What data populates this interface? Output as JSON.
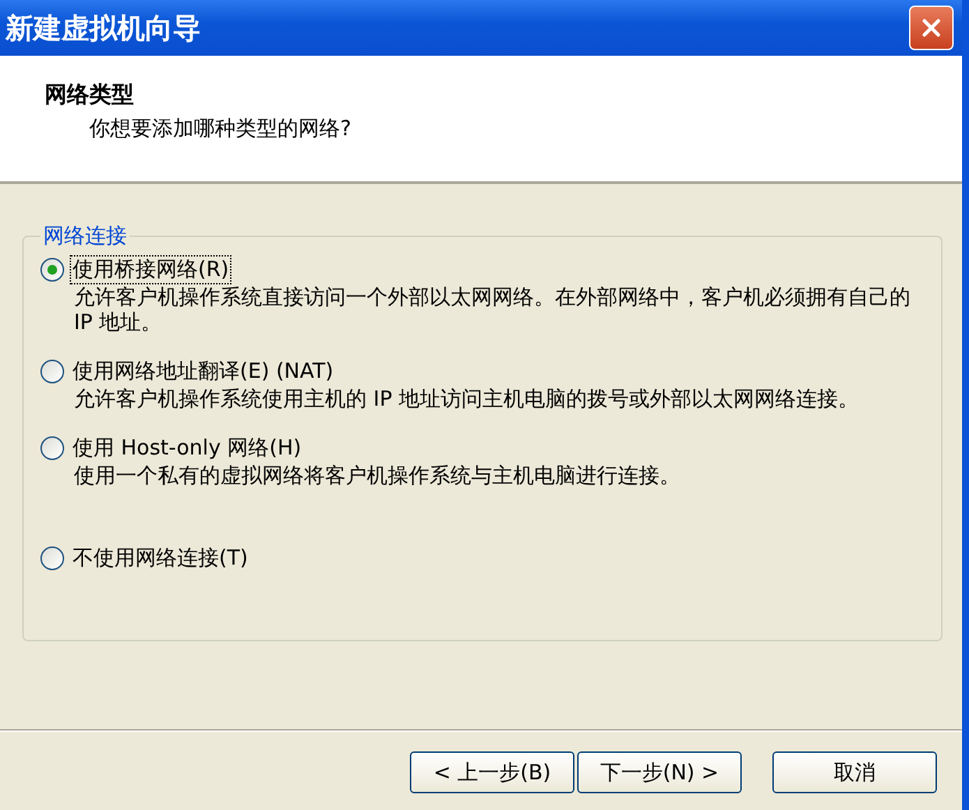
{
  "window": {
    "title": "新建虚拟机向导"
  },
  "header": {
    "title": "网络类型",
    "subtitle": "你想要添加哪种类型的网络?"
  },
  "group": {
    "title": "网络连接",
    "options": [
      {
        "label": "使用桥接网络(R)",
        "description": "允许客户机操作系统直接访问一个外部以太网网络。在外部网络中，客户机必须拥有自己的 IP 地址。",
        "selected": true
      },
      {
        "label": "使用网络地址翻译(E) (NAT)",
        "description": "允许客户机操作系统使用主机的 IP 地址访问主机电脑的拨号或外部以太网网络连接。",
        "selected": false
      },
      {
        "label": "使用 Host-only 网络(H)",
        "description": "使用一个私有的虚拟网络将客户机操作系统与主机电脑进行连接。",
        "selected": false
      },
      {
        "label": "不使用网络连接(T)",
        "selected": false
      }
    ]
  },
  "buttons": [
    {
      "label": "< 上一步(B)",
      "kind": "back"
    },
    {
      "label": "下一步(N) >",
      "kind": "next"
    },
    {
      "label": "取消",
      "kind": "cancel"
    }
  ]
}
